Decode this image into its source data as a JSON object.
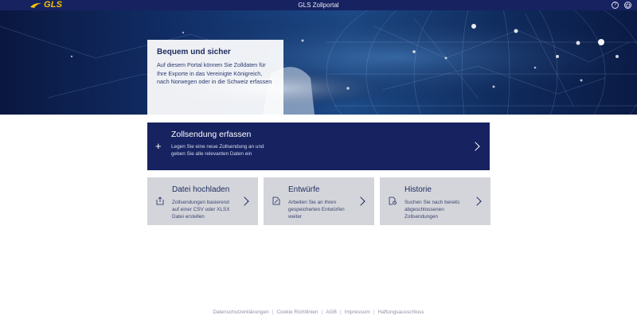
{
  "header": {
    "logo_text": "GLS",
    "title": "GLS Zollportal",
    "icons": [
      "help-icon",
      "power-icon"
    ]
  },
  "hero": {
    "card_title": "Bequem und sicher",
    "card_text": "Auf diesem Portal können Sie Zolldaten für Ihre Exporte in das Vereinigte Königreich, nach Norwegen oder in die Schweiz erfassen"
  },
  "primary_action": {
    "icon": "plus-icon",
    "title": "Zollsendung erfassen",
    "description": "Legen Sie eine neue Zollsendung an und geben Sie alle relevanten Daten ein"
  },
  "tiles": [
    {
      "icon": "upload-icon",
      "title": "Datei hochladen",
      "description": "Zollsendungen basierend auf einer CSV oder XLSX Datei erstellen"
    },
    {
      "icon": "draft-icon",
      "title": "Entwürfe",
      "description": "Arbeiten Sie an Ihren gespeicherten Entwürfen weiter"
    },
    {
      "icon": "history-icon",
      "title": "Historie",
      "description": "Suchen Sie nach bereits abgeschlossenen Zollsendungen"
    }
  ],
  "footer": {
    "links": [
      "Datenschutzerklärungen",
      "Cookie Richtlinien",
      "AGB",
      "Impressum",
      "Haftungsausschluss"
    ]
  },
  "colors": {
    "navy": "#172261",
    "logo_yellow": "#f5c400",
    "tile_grey": "#d4d5db"
  }
}
